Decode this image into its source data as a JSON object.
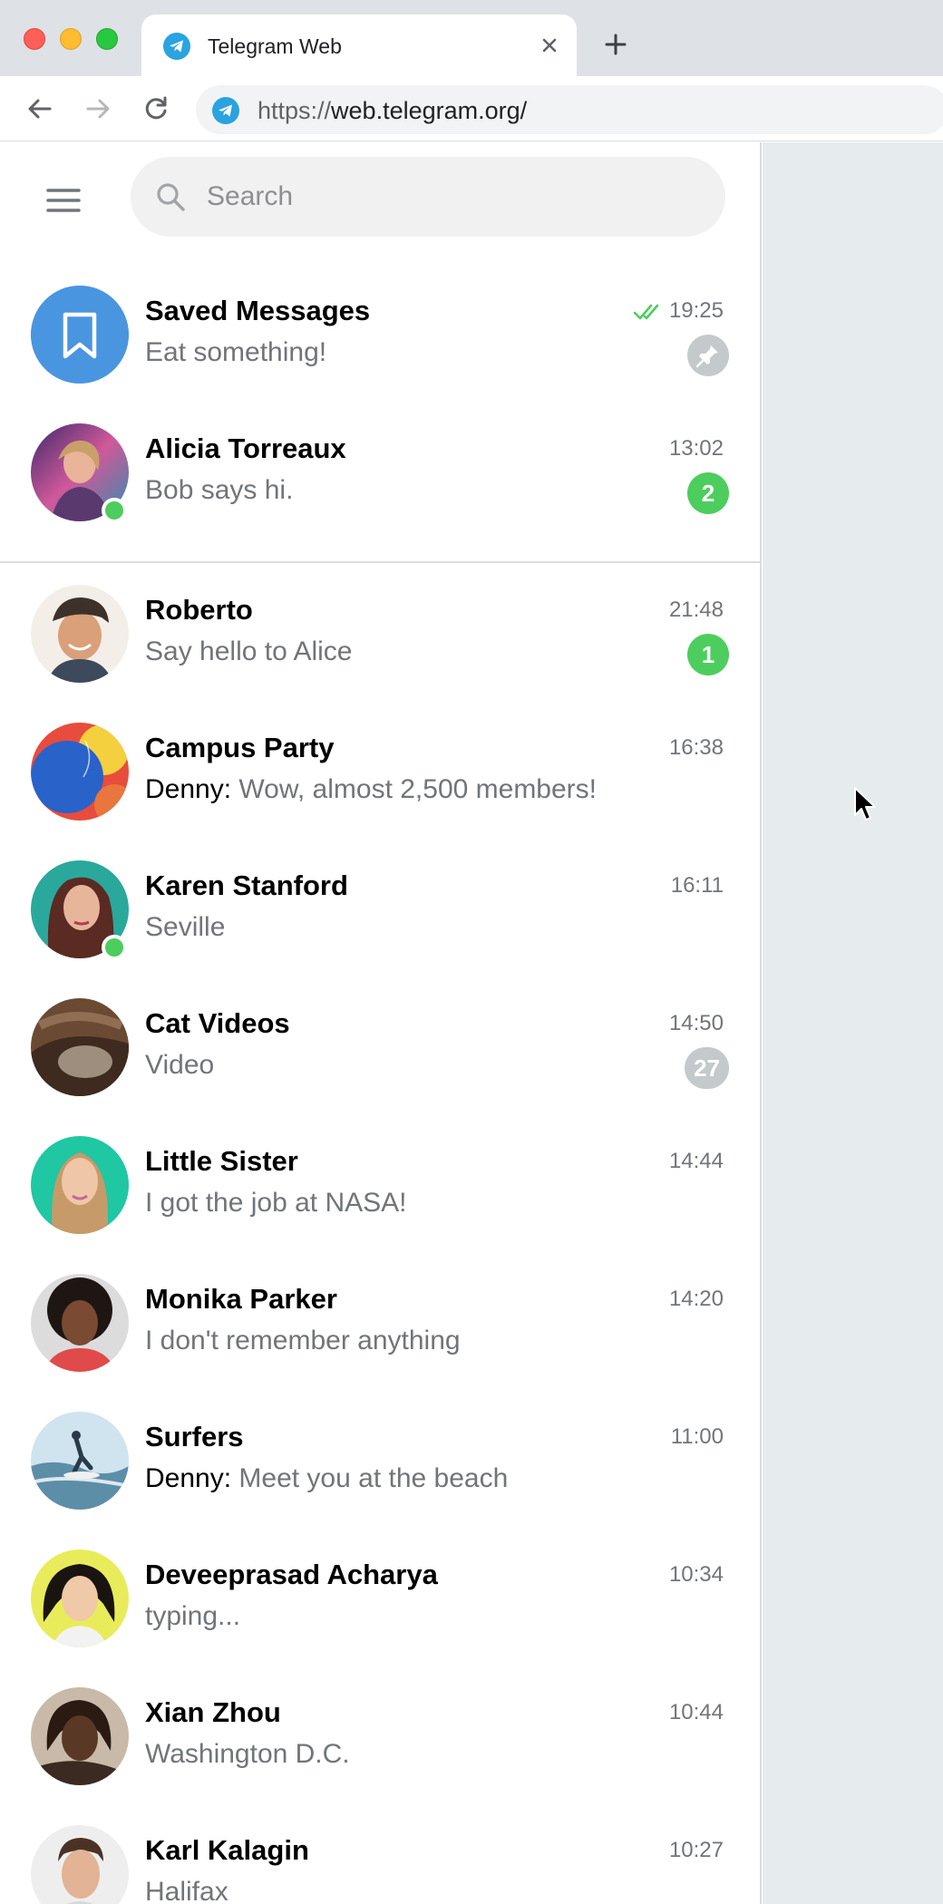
{
  "browser": {
    "tab_title": "Telegram Web",
    "url_scheme": "https://",
    "url_host": "web.telegram.org/"
  },
  "colors": {
    "accent": "#3390ec",
    "unread_badge": "#4dcd5e",
    "muted_badge": "#c4c9cc",
    "online": "#4dcd5e"
  },
  "sidebar": {
    "search_placeholder": "Search"
  },
  "chats": [
    {
      "name": "Saved Messages",
      "preview": "Eat something!",
      "sender": "",
      "time": "19:25",
      "badge": "",
      "pinned": true,
      "read": true,
      "online": false,
      "avatar": "bookmark-icon"
    },
    {
      "name": "Alicia Torreaux",
      "preview": "Bob says hi.",
      "sender": "",
      "time": "13:02",
      "badge": "2",
      "online": true
    },
    {
      "name": "Roberto",
      "preview": "Say hello to Alice",
      "sender": "",
      "time": "21:48",
      "badge": "1",
      "online": false
    },
    {
      "name": "Campus Party",
      "preview": "Wow, almost 2,500 members!",
      "sender": "Denny:",
      "time": "16:38",
      "badge": "",
      "online": false
    },
    {
      "name": "Karen Stanford",
      "preview": "Seville",
      "sender": "",
      "time": "16:11",
      "badge": "",
      "online": true
    },
    {
      "name": "Cat Videos",
      "preview": "Video",
      "sender": "",
      "time": "14:50",
      "badge": "27",
      "muted": true
    },
    {
      "name": "Little Sister",
      "preview": "I got the job at NASA!",
      "sender": "",
      "time": "14:44",
      "badge": ""
    },
    {
      "name": "Monika Parker",
      "preview": "I don't remember anything",
      "sender": "",
      "time": "14:20",
      "badge": ""
    },
    {
      "name": "Surfers",
      "preview": "Meet you at the beach",
      "sender": "Denny:",
      "time": "11:00",
      "badge": ""
    },
    {
      "name": "Deveeprasad Acharya",
      "preview": "typing...",
      "sender": "",
      "time": "10:34",
      "badge": ""
    },
    {
      "name": "Xian Zhou",
      "preview": "Washington D.C.",
      "sender": "",
      "time": "10:44",
      "badge": ""
    },
    {
      "name": "Karl Kalagin",
      "preview": "Halifax",
      "sender": "",
      "time": "10:27",
      "badge": ""
    }
  ]
}
